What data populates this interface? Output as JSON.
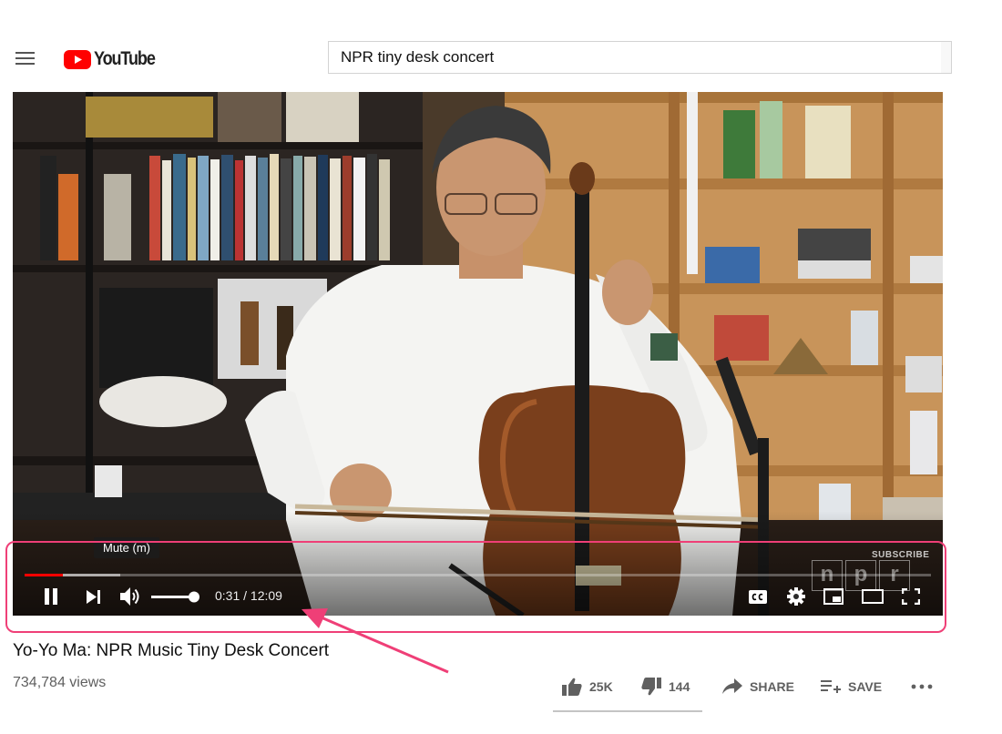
{
  "header": {
    "logo_text": "YouTube",
    "search_value": "NPR tiny desk concert",
    "colors": {
      "logo_red": "#ff0000"
    }
  },
  "player": {
    "tooltip": "Mute (m)",
    "time_current": "0:31",
    "time_separator": " / ",
    "time_total": "12:09",
    "progress_played_fraction": 0.0425,
    "progress_loaded_fraction": 0.106,
    "volume_fraction": 1.0,
    "watermark_subscribe": "SUBSCRIBE",
    "watermark_letters": [
      "n",
      "p",
      "r"
    ],
    "controls_left": [
      "pause-icon",
      "next-icon",
      "volume-icon"
    ],
    "controls_right": [
      "subtitles-icon",
      "settings-icon",
      "miniplayer-icon",
      "theater-mode-icon",
      "fullscreen-icon"
    ],
    "colors": {
      "played": "#ff0000",
      "highlight": "#ef3f77"
    }
  },
  "video": {
    "title": "Yo-Yo Ma: NPR Music Tiny Desk Concert",
    "views": "734,784 views"
  },
  "actions": {
    "like_count": "25K",
    "dislike_count": "144",
    "share_label": "SHARE",
    "save_label": "SAVE"
  }
}
